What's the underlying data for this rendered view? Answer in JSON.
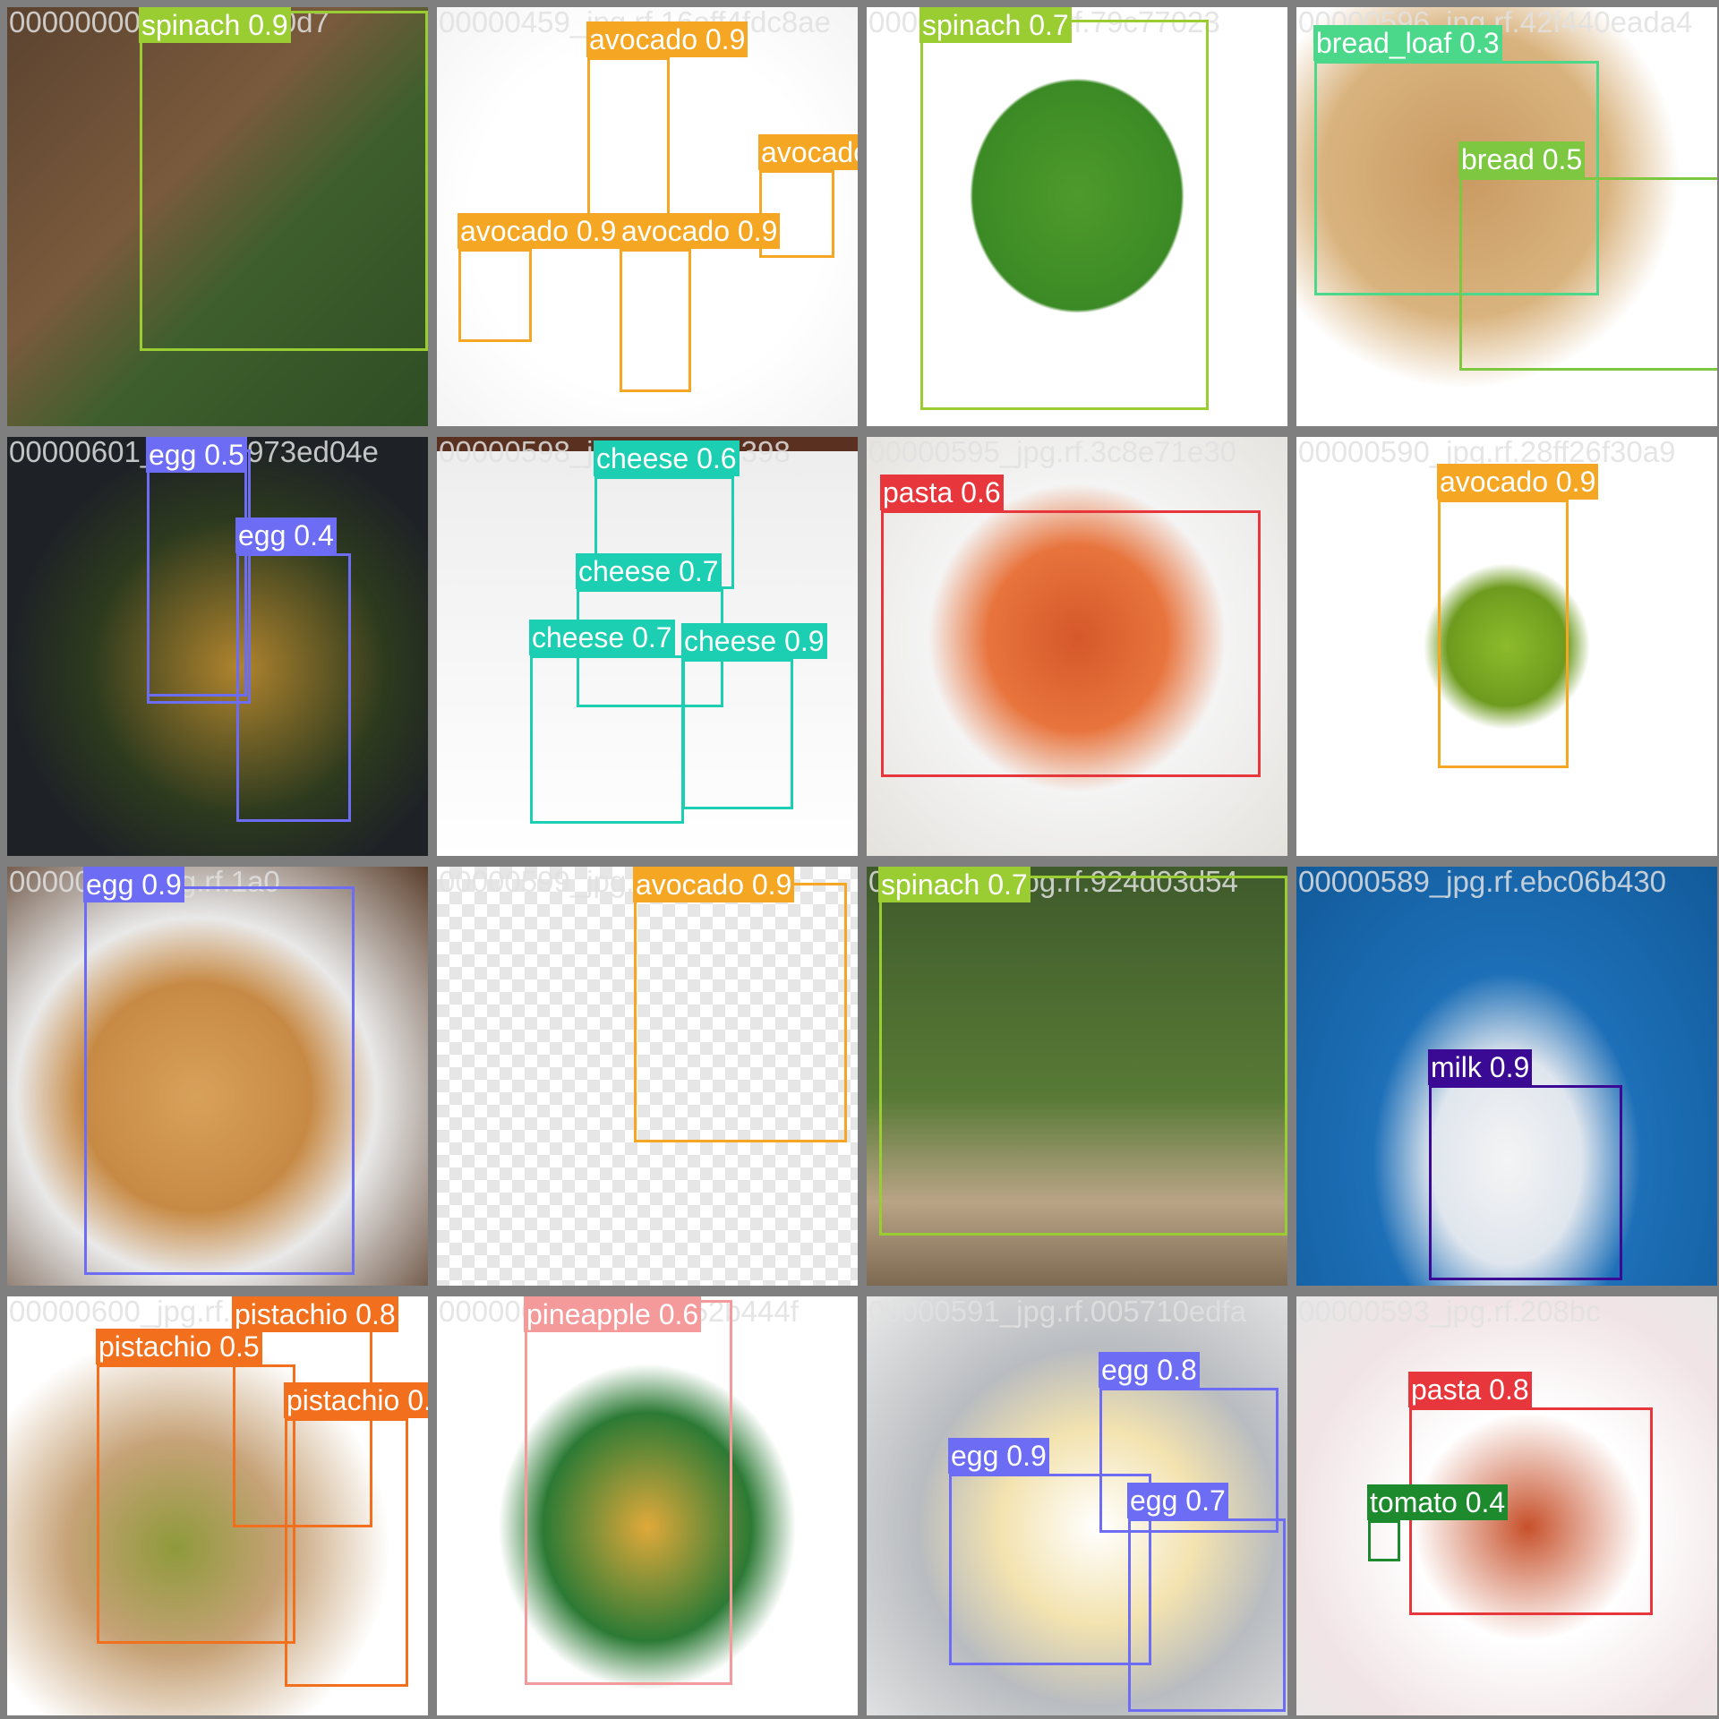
{
  "colors": {
    "spinach": "#9ACD32",
    "avocado": "#F5A623",
    "bread_loaf": "#4CD88A",
    "bread": "#7DC840",
    "egg": "#6C6CF5",
    "cheese": "#1CCFB3",
    "pasta": "#E8373C",
    "milk": "#3A0A94",
    "pistachio": "#F2701D",
    "pineapple": "#F59A9A",
    "tomato": "#1E8A2E"
  },
  "tiles": [
    {
      "filename": "00000000_jpg.rf.d040d7",
      "scene": "spinach bowl on wooden board",
      "detections": [
        {
          "label": "spinach 0.9",
          "class": "spinach",
          "confidence": 0.9
        }
      ]
    },
    {
      "filename": "00000459_jpg.rf.16eff4fdc8ae",
      "scene": "avocados halves and whole",
      "detections": [
        {
          "label": "avocado 0.9",
          "class": "avocado",
          "confidence": 0.9
        },
        {
          "label": "avocado 0.9",
          "class": "avocado",
          "confidence": 0.9
        },
        {
          "label": "avocado 0.9",
          "class": "avocado",
          "confidence": 0.9
        },
        {
          "label": "avocado 0.9",
          "class": "avocado",
          "confidence": 0.9
        }
      ]
    },
    {
      "filename": "00000592_jpg.rf.79c77023",
      "scene": "bunch of spinach",
      "detections": [
        {
          "label": "spinach 0.7",
          "class": "spinach",
          "confidence": 0.7
        }
      ]
    },
    {
      "filename": "00000596_jpg.rf.42f440eada4",
      "scene": "sliced bread loaf",
      "detections": [
        {
          "label": "bread_loaf 0.3",
          "class": "bread_loaf",
          "confidence": 0.3
        },
        {
          "label": "bread 0.5",
          "class": "bread",
          "confidence": 0.5
        }
      ]
    },
    {
      "filename": "00000601_jpg.rf.2973ed04e",
      "scene": "fried eggs with greens in pan",
      "detections": [
        {
          "label": "egg 0.6",
          "class": "egg",
          "confidence": 0.6
        },
        {
          "label": "egg 0.5",
          "class": "egg",
          "confidence": 0.5
        },
        {
          "label": "egg 0.4",
          "class": "egg",
          "confidence": 0.4
        }
      ]
    },
    {
      "filename": "00000598_jpg.rf.656c1398",
      "scene": "framed picture of swiss cheese",
      "detections": [
        {
          "label": "cheese 0.6",
          "class": "cheese",
          "confidence": 0.6
        },
        {
          "label": "cheese 0.7",
          "class": "cheese",
          "confidence": 0.7
        },
        {
          "label": "cheese 0.7",
          "class": "cheese",
          "confidence": 0.7
        },
        {
          "label": "cheese 0.9",
          "class": "cheese",
          "confidence": 0.9
        }
      ]
    },
    {
      "filename": "00000595_jpg.rf.3c8e71e30",
      "scene": "penne pasta on plate",
      "detections": [
        {
          "label": "pasta 0.6",
          "class": "pasta",
          "confidence": 0.6
        }
      ]
    },
    {
      "filename": "00000590_jpg.rf.28ff26f30a9",
      "scene": "single avocado half",
      "detections": [
        {
          "label": "avocado 0.9",
          "class": "avocado",
          "confidence": 0.9
        }
      ]
    },
    {
      "filename": "00000597_jpg.rf.1a0",
      "scene": "egg in toast on plate",
      "detections": [
        {
          "label": "egg 0.9",
          "class": "egg",
          "confidence": 0.9
        }
      ]
    },
    {
      "filename": "00000599_jpg.rf.e6b",
      "scene": "whole avocado and half",
      "detections": [
        {
          "label": "avocado 0.9",
          "class": "avocado",
          "confidence": 0.9
        }
      ]
    },
    {
      "filename": "00000594_jpg.rf.924d03d54",
      "scene": "potted eggplant plant",
      "detections": [
        {
          "label": "spinach 0.7",
          "class": "spinach",
          "confidence": 0.7
        }
      ]
    },
    {
      "filename": "00000589_jpg.rf.ebc06b430",
      "scene": "milk pouring into glass",
      "detections": [
        {
          "label": "milk 0.9",
          "class": "milk",
          "confidence": 0.9
        }
      ]
    },
    {
      "filename": "00000600_jpg.rf.",
      "scene": "pistachio nuts",
      "detections": [
        {
          "label": "pistachio 0.8",
          "class": "pistachio",
          "confidence": 0.8
        },
        {
          "label": "pistachio 0.5",
          "class": "pistachio",
          "confidence": 0.5
        },
        {
          "label": "pistachio 0.7",
          "class": "pistachio",
          "confidence": 0.7
        }
      ]
    },
    {
      "filename": "00000603_jpg.rf.ac52b444f",
      "scene": "pineapple with slices",
      "detections": [
        {
          "label": "pineapple 0.6",
          "class": "pineapple",
          "confidence": 0.6
        }
      ]
    },
    {
      "filename": "00000591_jpg.rf.005710edfa",
      "scene": "fried eggs in steel pan",
      "detections": [
        {
          "label": "egg 0.8",
          "class": "egg",
          "confidence": 0.8
        },
        {
          "label": "egg 0.9",
          "class": "egg",
          "confidence": 0.9
        },
        {
          "label": "egg 0.7",
          "class": "egg",
          "confidence": 0.7
        }
      ]
    },
    {
      "filename": "00000593_jpg.rf.208bc",
      "scene": "pasta bowl with tomatoes",
      "detections": [
        {
          "label": "pasta 0.8",
          "class": "pasta",
          "confidence": 0.8
        },
        {
          "label": "tomato 0.4",
          "class": "tomato",
          "confidence": 0.4
        }
      ]
    }
  ]
}
